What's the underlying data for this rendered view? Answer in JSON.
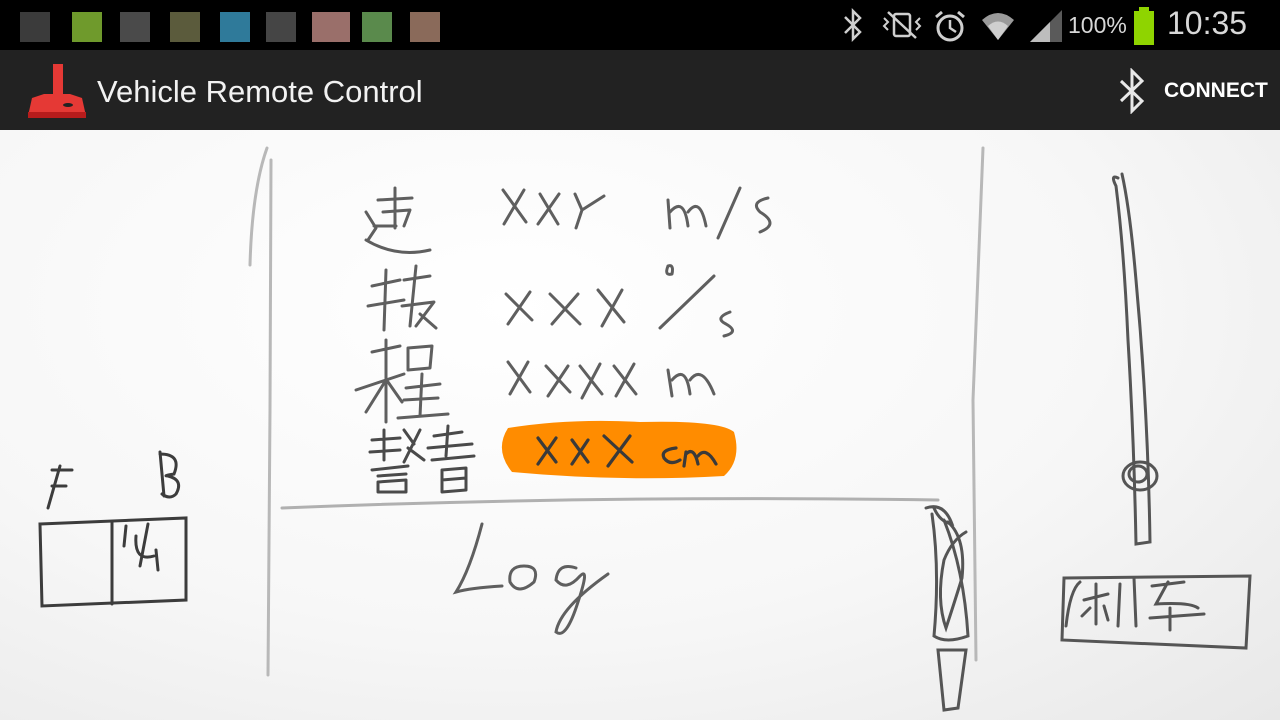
{
  "status_bar": {
    "battery_percent_text": "100%",
    "time": "10:35",
    "notification_colors": [
      "#3b3b3b",
      "#6f9a2c",
      "#4a4a4a",
      "#5b5b3c",
      "#2f7a9a",
      "#454545",
      "#9a6f6a",
      "#5a8a4c",
      "#8a6a5a"
    ],
    "battery_color": "#8fd400"
  },
  "action_bar": {
    "title": "Vehicle Remote Control",
    "connect_label": "CONNECT",
    "icon": "joystick-icon",
    "connect_icon": "bluetooth-icon"
  },
  "sketch": {
    "left_panel": {
      "label_f": "F",
      "label_b": "B"
    },
    "log_label": "Log",
    "warning_color": "#ff8c00",
    "brake_button_label": "刹车"
  }
}
